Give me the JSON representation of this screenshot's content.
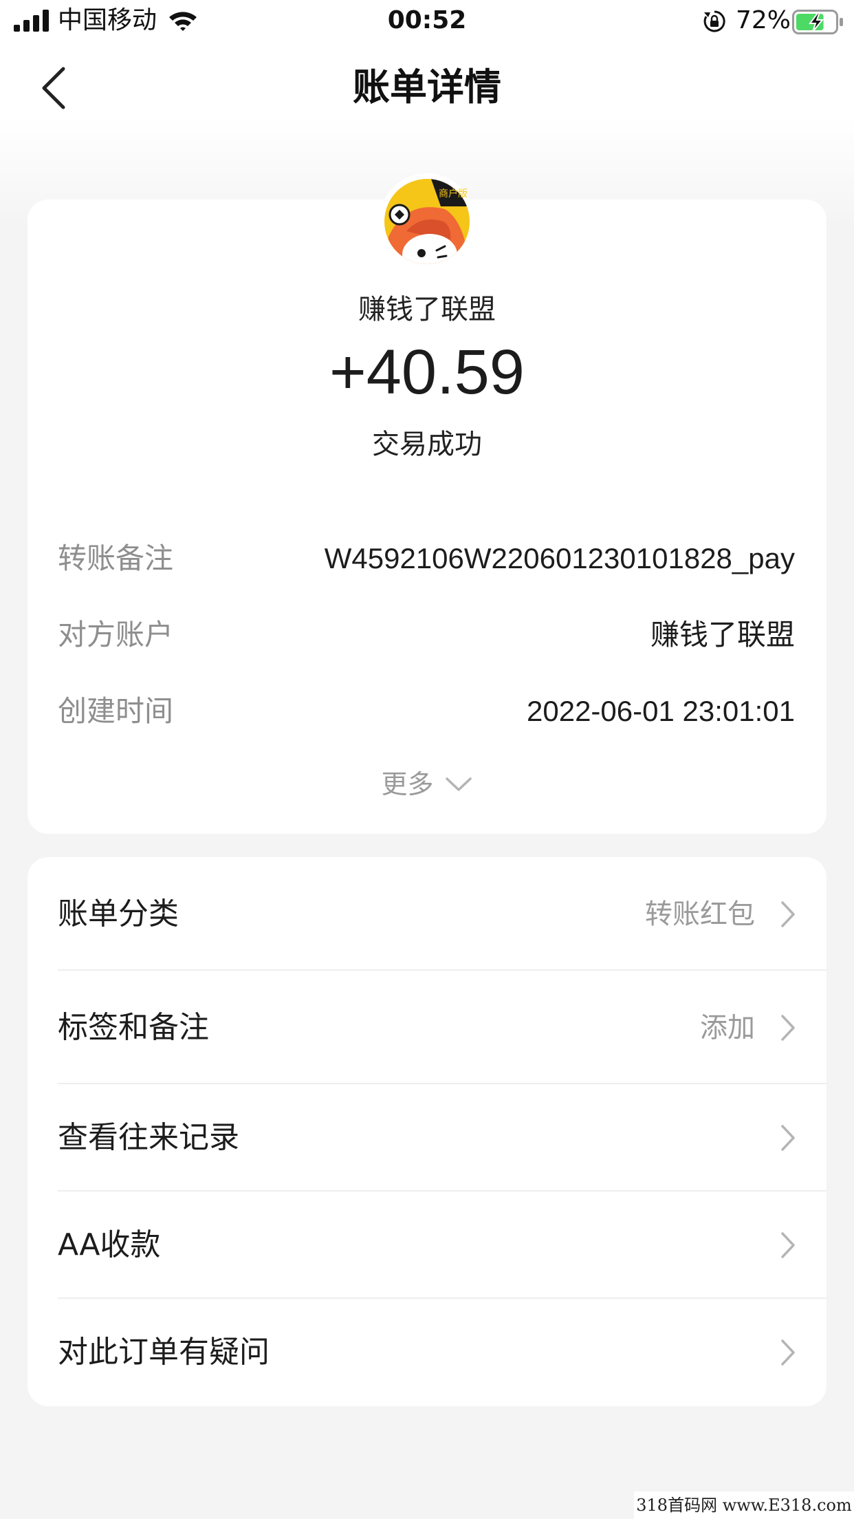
{
  "status_bar": {
    "carrier": "中国移动",
    "time": "00:52",
    "battery_percent": "72%",
    "battery_level": 0.72,
    "icons": [
      "signal-icon",
      "wifi-icon",
      "rotation-lock-icon",
      "battery-charging-icon"
    ]
  },
  "nav": {
    "title": "账单详情",
    "back_icon": "chevron-left-icon"
  },
  "merchant": {
    "avatar_badge": "商户版",
    "name": "赚钱了联盟"
  },
  "transaction": {
    "amount": "+40.59",
    "status": "交易成功"
  },
  "details": [
    {
      "label": "转账备注",
      "value": "W4592106W220601230101828_pay"
    },
    {
      "label": "对方账户",
      "value": "赚钱了联盟"
    },
    {
      "label": "创建时间",
      "value": "2022-06-01 23:01:01"
    }
  ],
  "more": {
    "label": "更多",
    "icon": "chevron-down-icon"
  },
  "menu": [
    {
      "label": "账单分类",
      "value": "转账红包"
    },
    {
      "label": "标签和备注",
      "value": "添加"
    },
    {
      "label": "查看往来记录",
      "value": ""
    },
    {
      "label": "AA收款",
      "value": ""
    },
    {
      "label": "对此订单有疑问",
      "value": ""
    }
  ],
  "watermark": "318首码网 www.E318.com",
  "colors": {
    "background": "#f4f4f4",
    "card": "#ffffff",
    "label_gray": "#8e8e8e",
    "text_dark": "#1c1c1c",
    "battery_green": "#4cd964",
    "avatar_yellow": "#f5c518",
    "avatar_orange": "#f06a35"
  }
}
